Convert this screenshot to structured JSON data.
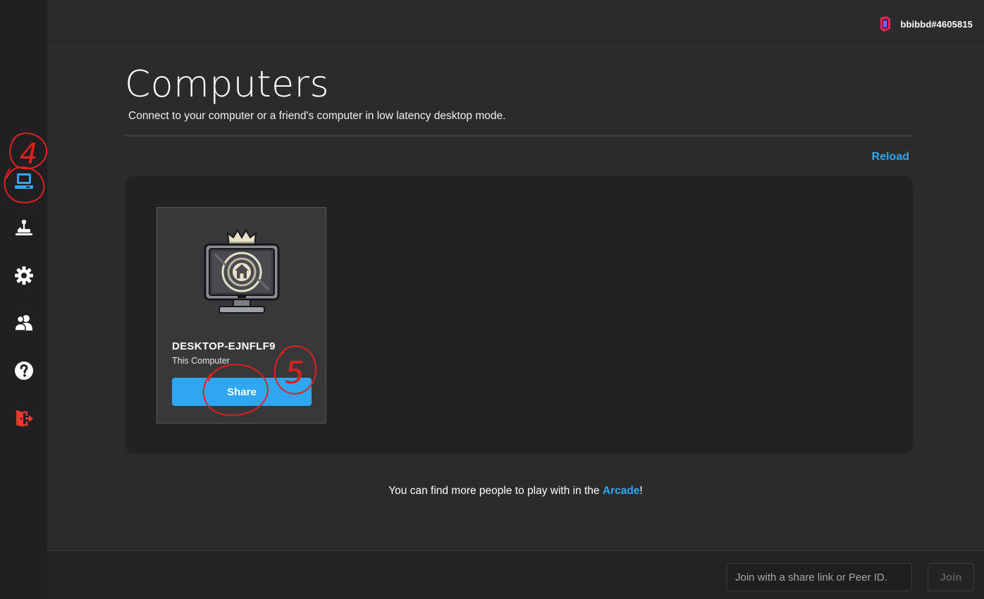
{
  "topbar": {
    "username": "bbibbd#4605815",
    "logo_icon": "brand-logo-icon"
  },
  "sidebar": {
    "items": [
      {
        "name": "computers",
        "icon": "laptop-icon",
        "color": "#2ea7f0",
        "active": true
      },
      {
        "name": "arcade",
        "icon": "joystick-icon",
        "color": "#ffffff"
      },
      {
        "name": "settings",
        "icon": "gear-icon",
        "color": "#ffffff"
      },
      {
        "name": "friends",
        "icon": "users-icon",
        "color": "#ffffff"
      },
      {
        "name": "help",
        "icon": "question-icon",
        "color": "#ffffff"
      },
      {
        "name": "logout",
        "icon": "logout-icon",
        "color": "#e8392f"
      }
    ]
  },
  "main": {
    "title": "Computers",
    "subtitle": "Connect to your computer or a friend's computer in low latency desktop mode.",
    "reload_label": "Reload",
    "computers": [
      {
        "name": "DESKTOP-EJNFLF9",
        "subtitle": "This Computer",
        "share_label": "Share",
        "icon": "home-computer-icon"
      }
    ],
    "arcade_prefix": "You can find more people to play with in the ",
    "arcade_link": "Arcade",
    "arcade_suffix": "!"
  },
  "footer": {
    "join_placeholder": "Join with a share link or Peer ID.",
    "join_value": "",
    "join_label": "Join"
  },
  "annotations": {
    "labels": [
      "4",
      "5"
    ],
    "color": "#e0201c"
  },
  "colors": {
    "accent": "#2ea7f0",
    "danger": "#e8392f",
    "background": "#2b2b2c"
  }
}
